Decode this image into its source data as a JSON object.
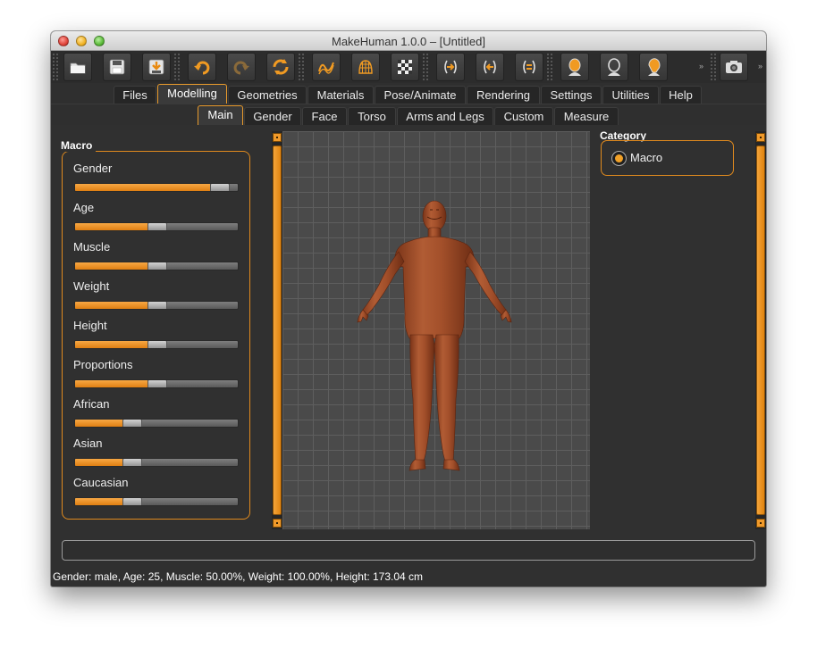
{
  "window": {
    "title": "MakeHuman 1.0.0 – [Untitled]"
  },
  "toolbar": {
    "icons": [
      "folder-icon",
      "save-icon",
      "export-icon",
      "undo-icon",
      "redo-icon",
      "reset-icon",
      "smooth-icon",
      "wireframe-icon",
      "background-icon",
      "front-view-icon",
      "back-view-icon",
      "side-view-icon",
      "face-front-icon",
      "face-back-icon",
      "face-side-icon",
      "camera-icon"
    ],
    "more_symbol": "»"
  },
  "menu_tabs": [
    {
      "label": "Files",
      "active": false
    },
    {
      "label": "Modelling",
      "active": true
    },
    {
      "label": "Geometries",
      "active": false
    },
    {
      "label": "Materials",
      "active": false
    },
    {
      "label": "Pose/Animate",
      "active": false
    },
    {
      "label": "Rendering",
      "active": false
    },
    {
      "label": "Settings",
      "active": false
    },
    {
      "label": "Utilities",
      "active": false
    },
    {
      "label": "Help",
      "active": false
    }
  ],
  "sub_tabs": [
    {
      "label": "Main",
      "active": true
    },
    {
      "label": "Gender",
      "active": false
    },
    {
      "label": "Face",
      "active": false
    },
    {
      "label": "Torso",
      "active": false
    },
    {
      "label": "Arms and Legs",
      "active": false
    },
    {
      "label": "Custom",
      "active": false
    },
    {
      "label": "Measure",
      "active": false
    }
  ],
  "macro": {
    "title": "Macro",
    "sliders": [
      {
        "label": "Gender",
        "value": 0.93
      },
      {
        "label": "Age",
        "value": 0.5
      },
      {
        "label": "Muscle",
        "value": 0.5
      },
      {
        "label": "Weight",
        "value": 0.5
      },
      {
        "label": "Height",
        "value": 0.5
      },
      {
        "label": "Proportions",
        "value": 0.5
      },
      {
        "label": "African",
        "value": 0.33
      },
      {
        "label": "Asian",
        "value": 0.33
      },
      {
        "label": "Caucasian",
        "value": 0.33
      }
    ]
  },
  "category": {
    "title": "Category",
    "option": "Macro",
    "selected": true
  },
  "status": {
    "text": "Gender: male, Age: 25, Muscle: 50.00%, Weight: 100.00%, Height: 173.04 cm"
  },
  "colors": {
    "accent": "#e89a2c",
    "panel_bg": "#303030",
    "skin": "#a24f2a"
  }
}
